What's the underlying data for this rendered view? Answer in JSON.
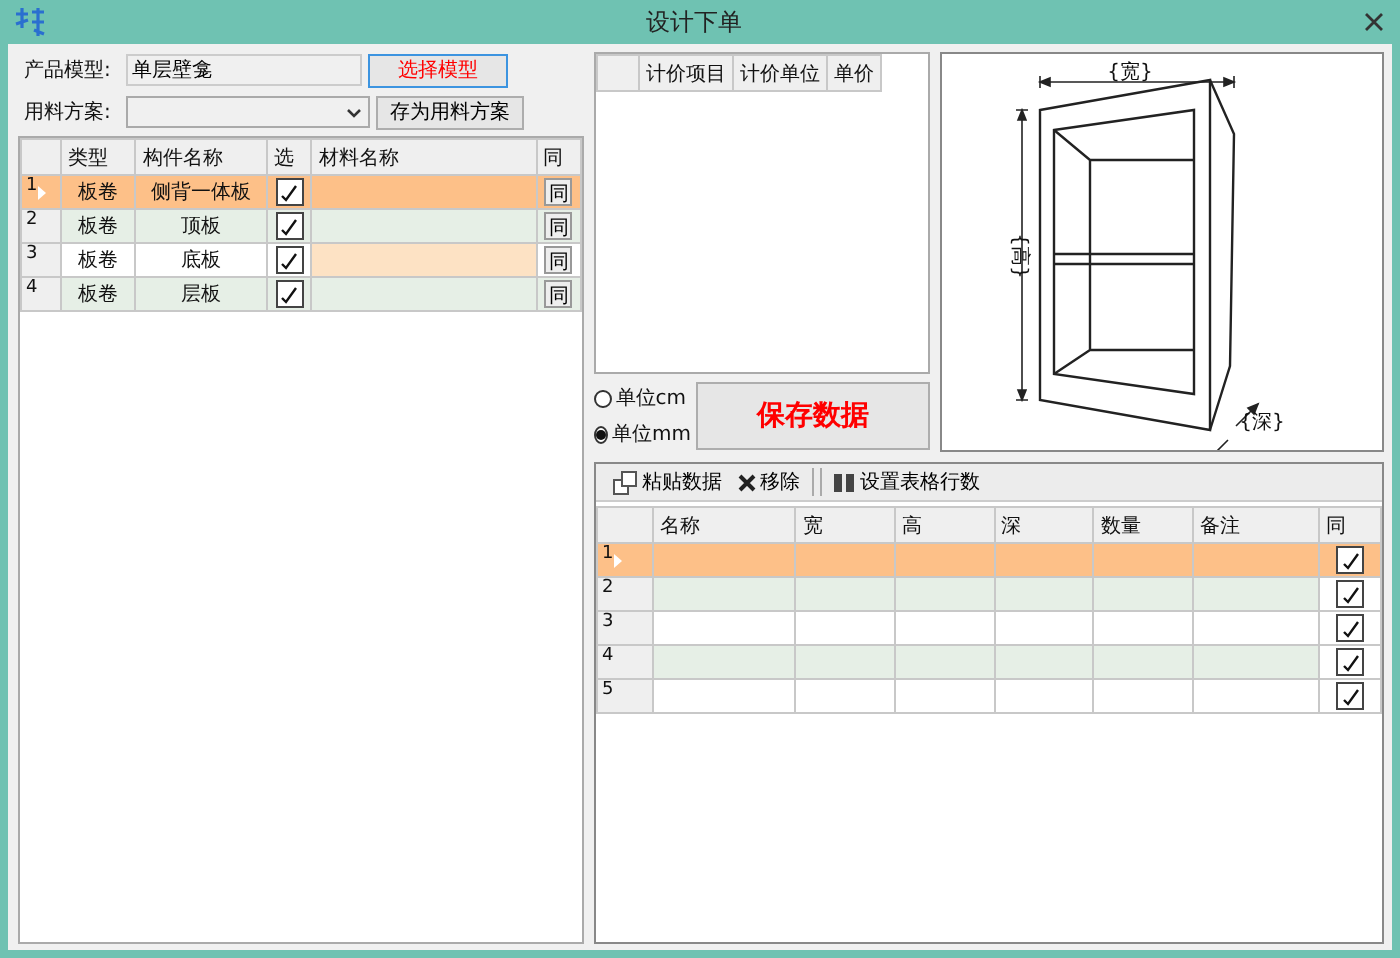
{
  "window": {
    "title": "设计下单"
  },
  "product_model": {
    "label": "产品模型:",
    "value": "单层壁龛"
  },
  "select_model_button": "选择模型",
  "material_plan": {
    "label": "用料方案:"
  },
  "save_plan_button": "存为用料方案",
  "parts_table": {
    "columns": [
      "类型",
      "构件名称",
      "选",
      "材料名称",
      "同"
    ],
    "rows": [
      {
        "index": "1",
        "type": "板卷",
        "name": "侧背一体板",
        "checked": true,
        "highlighted": false,
        "same": "同",
        "selected": true
      },
      {
        "index": "2",
        "type": "板卷",
        "name": "顶板",
        "checked": true,
        "highlighted": false,
        "same": "同",
        "selected": false
      },
      {
        "index": "3",
        "type": "板卷",
        "name": "底板",
        "checked": true,
        "highlighted": true,
        "same": "同",
        "selected": false
      },
      {
        "index": "4",
        "type": "板卷",
        "name": "层板",
        "checked": true,
        "highlighted": false,
        "same": "同",
        "selected": false
      }
    ]
  },
  "pricing_table": {
    "columns": [
      "计价项目",
      "计价单位",
      "单价"
    ]
  },
  "units": [
    {
      "label": "单位cm",
      "selected": false
    },
    {
      "label": "单位mm",
      "selected": true
    }
  ],
  "save_button": "保存数据",
  "drawing": {
    "width_label": "{宽}",
    "height_label": "{高}",
    "depth_label": "{深}"
  },
  "toolbar": [
    {
      "label": "粘贴数据",
      "kind": "paste"
    },
    {
      "label": "移除",
      "kind": "remove"
    },
    {
      "label": "设置表格行数",
      "kind": "rows"
    }
  ],
  "size_table": {
    "columns": [
      "名称",
      "宽",
      "高",
      "深",
      "数量",
      "备注",
      "同"
    ],
    "rows": [
      {
        "index": "1",
        "checked": true,
        "selected": true
      },
      {
        "index": "2",
        "checked": true,
        "selected": false
      },
      {
        "index": "3",
        "checked": true,
        "selected": false
      },
      {
        "index": "4",
        "checked": true,
        "selected": false
      },
      {
        "index": "5",
        "checked": true,
        "selected": false
      }
    ]
  }
}
